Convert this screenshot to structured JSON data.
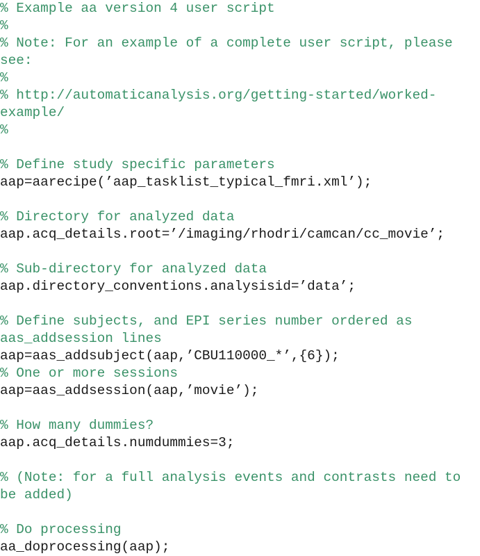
{
  "document": {
    "kind": "matlab-script-listing",
    "background_color": "#ffffff",
    "comment_color": "#3a9268",
    "code_color": "#1a1a1a"
  },
  "listing": {
    "lines": [
      {
        "text": "% Example aa version 4 user script",
        "kind": "comment"
      },
      {
        "text": "%",
        "kind": "comment"
      },
      {
        "text": "% Note: For an example of a complete user script, please see:",
        "kind": "comment"
      },
      {
        "text": "%",
        "kind": "comment"
      },
      {
        "text": "% http://automaticanalysis.org/getting-started/worked-example/",
        "kind": "comment"
      },
      {
        "text": "%",
        "kind": "comment"
      },
      {
        "text": "",
        "kind": "blank"
      },
      {
        "text": "% Define study specific parameters",
        "kind": "comment"
      },
      {
        "text": "aap=aarecipe(’aap_tasklist_typical_fmri.xml’);",
        "kind": "code"
      },
      {
        "text": "",
        "kind": "blank"
      },
      {
        "text": "% Directory for analyzed data",
        "kind": "comment"
      },
      {
        "text": "aap.acq_details.root=’/imaging/rhodri/camcan/cc_movie’;",
        "kind": "code"
      },
      {
        "text": "",
        "kind": "blank"
      },
      {
        "text": "% Sub-directory for analyzed data",
        "kind": "comment"
      },
      {
        "text": "aap.directory_conventions.analysisid=’data’;",
        "kind": "code"
      },
      {
        "text": "",
        "kind": "blank"
      },
      {
        "text": "% Define subjects, and EPI series number ordered as aas_addsession lines",
        "kind": "comment"
      },
      {
        "text": "aap=aas_addsubject(aap,’CBU110000_*’,{6});",
        "kind": "code"
      },
      {
        "text": "% One or more sessions",
        "kind": "comment"
      },
      {
        "text": "aap=aas_addsession(aap,’movie’);",
        "kind": "code"
      },
      {
        "text": "",
        "kind": "blank"
      },
      {
        "text": "% How many dummies?",
        "kind": "comment"
      },
      {
        "text": "aap.acq_details.numdummies=3;",
        "kind": "code"
      },
      {
        "text": "",
        "kind": "blank"
      },
      {
        "text": "% (Note: for a full analysis events and contrasts need to be added)",
        "kind": "comment"
      },
      {
        "text": "",
        "kind": "blank"
      },
      {
        "text": "% Do processing",
        "kind": "comment"
      },
      {
        "text": "aa_doprocessing(aap);",
        "kind": "code"
      }
    ]
  }
}
